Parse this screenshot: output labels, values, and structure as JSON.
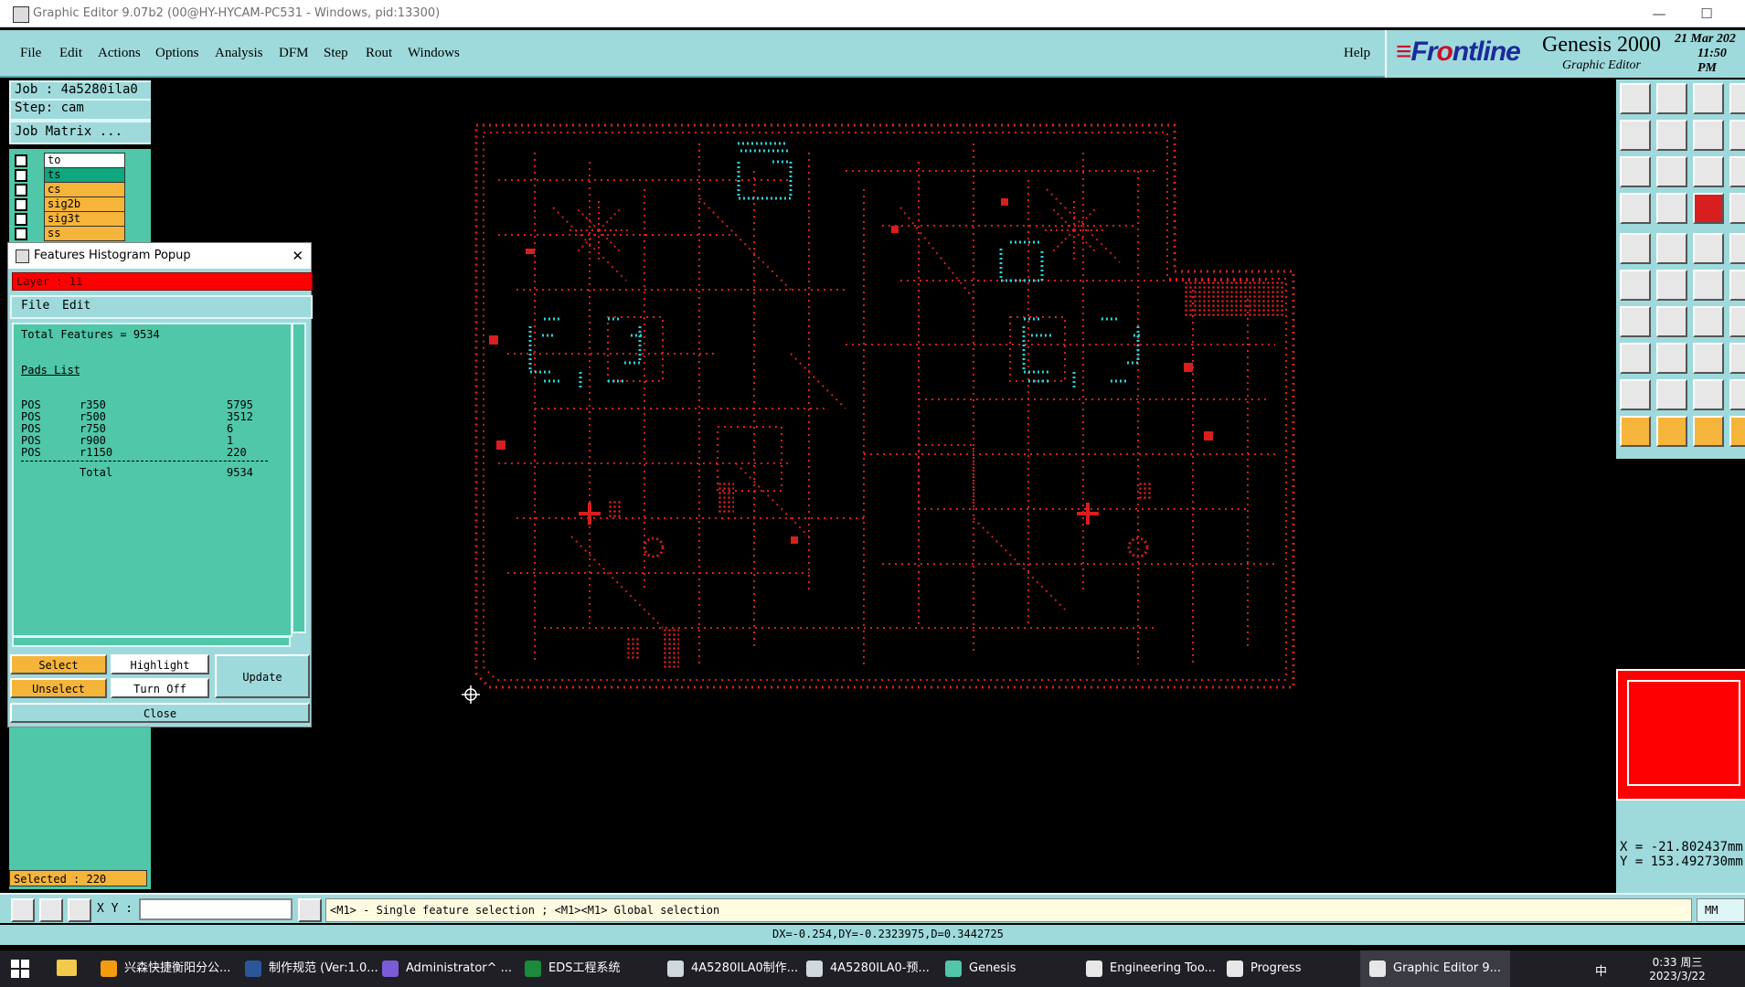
{
  "window": {
    "title": "Graphic Editor 9.07b2 (00@HY-HYCAM-PC531 - Windows, pid:13300)",
    "controls": {
      "minimize": "—",
      "maximize": "☐",
      "close": "✕"
    }
  },
  "menu": {
    "items": [
      "File",
      "Edit",
      "Actions",
      "Options",
      "Analysis",
      "DFM",
      "Step",
      "Rout",
      "Windows"
    ],
    "help": "Help"
  },
  "branding": {
    "logo_left": "Fr",
    "logo_o": "o",
    "logo_right": "ntline",
    "product": "Genesis 2000",
    "subtitle": "Graphic Editor",
    "date_line": "21 Mar 202",
    "time_line": "11:50 PM"
  },
  "job": {
    "job_label": "Job : 4a5280ila0",
    "step_label": "Step: cam",
    "matrix_button": "Job Matrix ..."
  },
  "layers": [
    {
      "name": "to",
      "color": "#ffffff"
    },
    {
      "name": "ts",
      "color": "#10a67f"
    },
    {
      "name": "cs",
      "color": "#f5b43a"
    },
    {
      "name": "sig2b",
      "color": "#f5b43a"
    },
    {
      "name": "sig3t",
      "color": "#f5b43a"
    },
    {
      "name": "ss",
      "color": "#f5b43a"
    }
  ],
  "selected_count": "Selected : 220",
  "popup": {
    "title": "Features Histogram Popup",
    "close": "✕",
    "layer": "Layer : 11",
    "menu": [
      "File",
      "Edit"
    ],
    "total_features": "Total Features = 9534",
    "pads_header": "Pads List",
    "rows": [
      {
        "pol": "POS",
        "sym": "r350",
        "count": "5795"
      },
      {
        "pol": "POS",
        "sym": "r500",
        "count": "3512"
      },
      {
        "pol": "POS",
        "sym": "r750",
        "count": "6"
      },
      {
        "pol": "POS",
        "sym": "r900",
        "count": "1"
      },
      {
        "pol": "POS",
        "sym": "r1150",
        "count": "220"
      }
    ],
    "total_label": "Total",
    "total_value": "9534",
    "buttons": {
      "select": "Select",
      "highlight": "Highlight",
      "update": "Update",
      "unselect": "Unselect",
      "turn_off": "Turn Off",
      "close": "Close"
    }
  },
  "bottom": {
    "xy_label": "X Y :",
    "hint": "<M1> - Single feature selection ; <M1><M1> Global selection",
    "delta": "DX=-0.254,DY=-0.2323975,D=0.3442725",
    "units": "MM",
    "coord_x": "X = -21.802437mm",
    "coord_y": "Y = 153.492730mm"
  },
  "taskbar": {
    "items": [
      "兴森快捷衡阳分公...",
      "制作规范 (Ver:1.0...",
      "Administrator^ ...",
      "EDS工程系统",
      "4A5280ILA0制作...",
      "4A5280ILA0-预...",
      "Genesis",
      "Engineering Too...",
      "Progress",
      "Graphic Editor 9..."
    ],
    "time": "0:33 周三",
    "date": "2023/3/22",
    "tray_ime": "中"
  },
  "colors": {
    "panel": "#9edadc",
    "layer_bg": "#4fc7a8",
    "pad_red": "#d81e1e",
    "pad_cyan": "#2ad2d8",
    "highlight_orange": "#f5b43a"
  }
}
